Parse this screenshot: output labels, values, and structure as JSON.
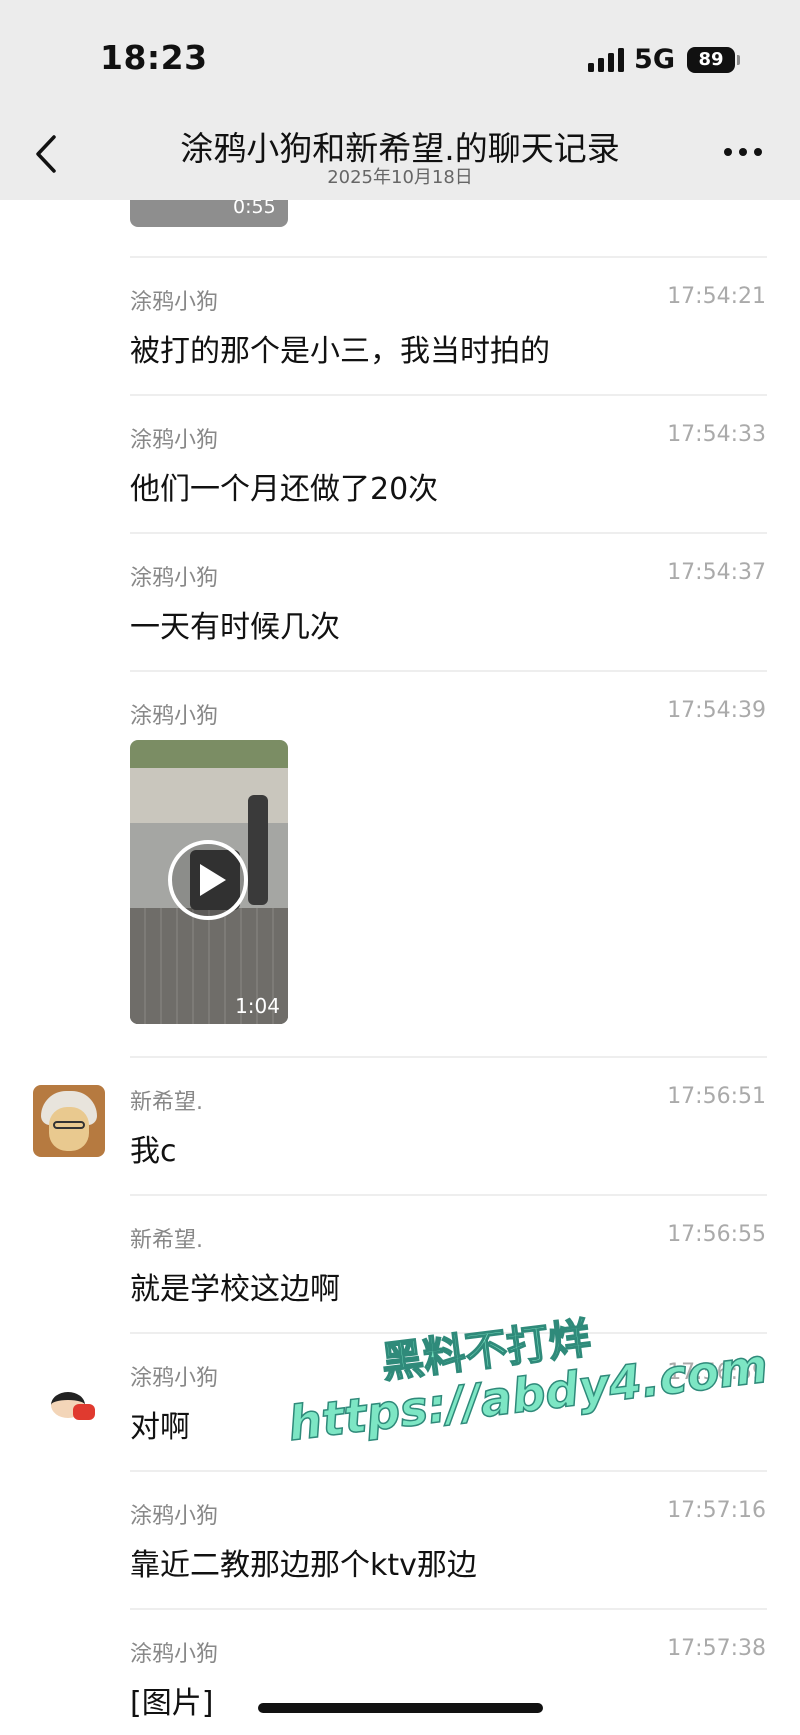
{
  "status_bar": {
    "time": "18:23",
    "network": "5G",
    "battery": "89"
  },
  "header": {
    "title": "涂鸦小狗和新希望.的聊天记录",
    "date": "2025年10月18日"
  },
  "previous_video": {
    "duration": "0:55"
  },
  "messages": [
    {
      "sender": "涂鸦小狗",
      "time": "17:54:21",
      "text": "被打的那个是小三，我当时拍的"
    },
    {
      "sender": "涂鸦小狗",
      "time": "17:54:33",
      "text": "他们一个月还做了20次"
    },
    {
      "sender": "涂鸦小狗",
      "time": "17:54:37",
      "text": "一天有时候几次"
    },
    {
      "sender": "涂鸦小狗",
      "time": "17:54:39",
      "video_duration": "1:04"
    },
    {
      "sender": "新希望.",
      "time": "17:56:51",
      "text": "我c"
    },
    {
      "sender": "新希望.",
      "time": "17:56:55",
      "text": "就是学校这边啊"
    },
    {
      "sender": "涂鸦小狗",
      "time": "17:56:59",
      "text": "对啊"
    },
    {
      "sender": "涂鸦小狗",
      "time": "17:57:16",
      "text": "靠近二教那边那个ktv那边"
    },
    {
      "sender": "涂鸦小狗",
      "time": "17:57:38",
      "text": "[图片]"
    }
  ],
  "watermark": {
    "line1": "黑料不打烊",
    "line2": "https://abdy4.com"
  },
  "colors": {
    "header_bg": "#ececec",
    "watermark": "#7de6c4"
  }
}
